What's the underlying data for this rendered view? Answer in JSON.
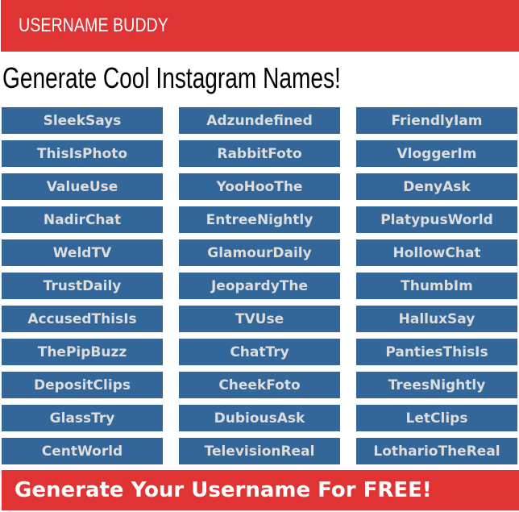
{
  "header": {
    "brand": "USERNAME BUDDY"
  },
  "page_title": "Generate Cool Instagram Names!",
  "names": [
    "SleekSays",
    "Adzundefined",
    "FriendlyIam",
    "ThisIsPhoto",
    "RabbitFoto",
    "VloggerIm",
    "ValueUse",
    "YooHooThe",
    "DenyAsk",
    "NadirChat",
    "EntreeNightly",
    "PlatypusWorld",
    "WeldTV",
    "GlamourDaily",
    "HollowChat",
    "TrustDaily",
    "JeopardyThe",
    "ThumbIm",
    "AccusedThisIs",
    "TVUse",
    "HalluxSay",
    "ThePipBuzz",
    "ChatTry",
    "PantiesThisIs",
    "DepositClips",
    "CheekFoto",
    "TreesNightly",
    "GlassTry",
    "DubiousAsk",
    "LetClips",
    "CentWorld",
    "TelevisionReal",
    "LotharioTheReal"
  ],
  "cta": {
    "label": "Generate Your Username For FREE!"
  },
  "colors": {
    "brand_red": "#e03434",
    "name_button_blue": "#336699",
    "name_button_text": "#dddddd"
  }
}
